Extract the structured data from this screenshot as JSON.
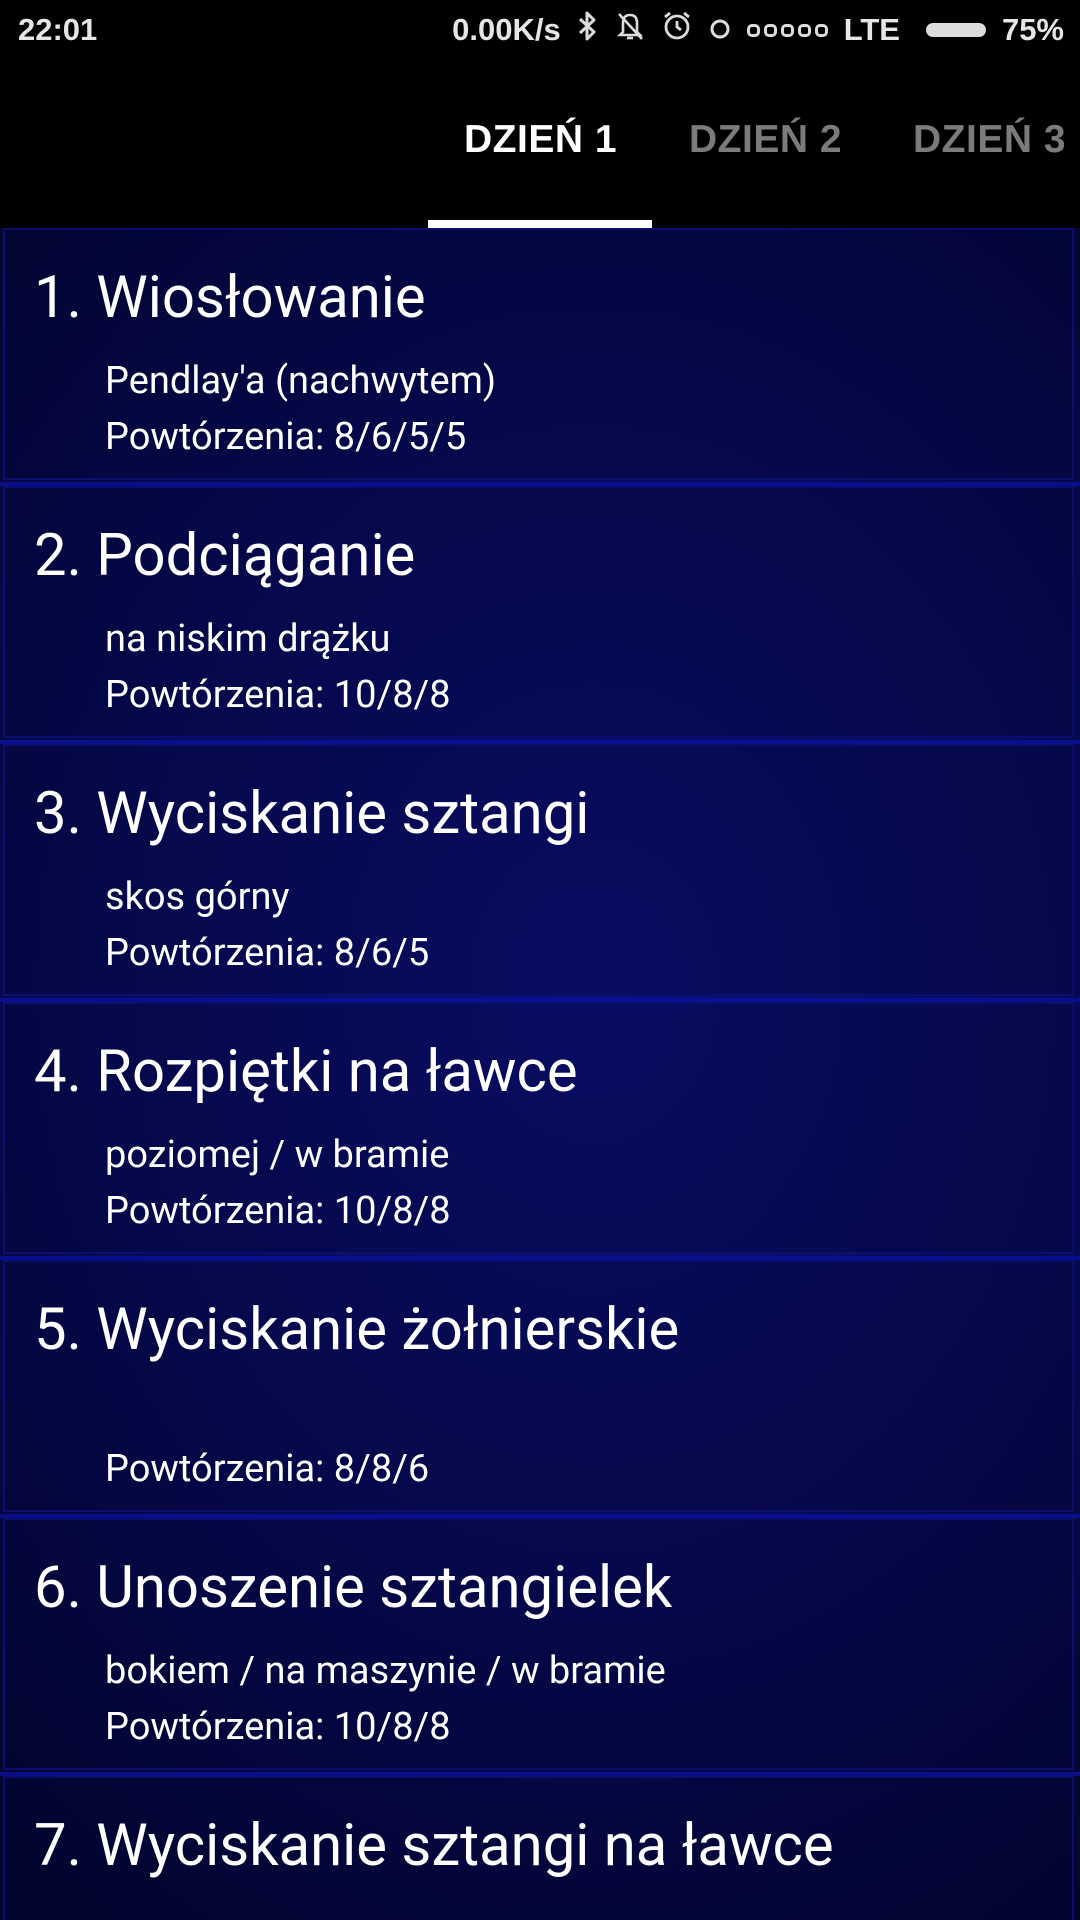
{
  "status_bar": {
    "time": "22:01",
    "speed": "0.00K/s",
    "network": "LTE",
    "battery": "75%",
    "icons": [
      "bluetooth-icon",
      "bell-off-icon",
      "alarm-icon",
      "circle-icon",
      "signal-icon",
      "battery-icon"
    ]
  },
  "tabs": [
    {
      "label": "DZIEŃ 1",
      "active": true
    },
    {
      "label": "DZIEŃ 2",
      "active": false
    },
    {
      "label": "DZIEŃ 3",
      "active": false
    }
  ],
  "exercises": [
    {
      "title": "1. Wiosłowanie",
      "subtitle": "Pendlay'a (nachwytem)",
      "reps": "Powtórzenia: 8/6/5/5"
    },
    {
      "title": "2. Podciąganie",
      "subtitle": "na niskim drążku",
      "reps": "Powtórzenia: 10/8/8"
    },
    {
      "title": "3. Wyciskanie sztangi",
      "subtitle": "skos górny",
      "reps": "Powtórzenia: 8/6/5"
    },
    {
      "title": "4. Rozpiętki na ławce",
      "subtitle": "poziomej / w bramie",
      "reps": "Powtórzenia: 10/8/8"
    },
    {
      "title": "5. Wyciskanie żołnierskie",
      "subtitle": "",
      "reps": "Powtórzenia: 8/8/6"
    },
    {
      "title": "6. Unoszenie sztangielek",
      "subtitle": "bokiem / na maszynie / w bramie",
      "reps": "Powtórzenia: 10/8/8"
    },
    {
      "title": "7. Wyciskanie sztangi na ławce",
      "subtitle": "",
      "reps": ""
    }
  ]
}
